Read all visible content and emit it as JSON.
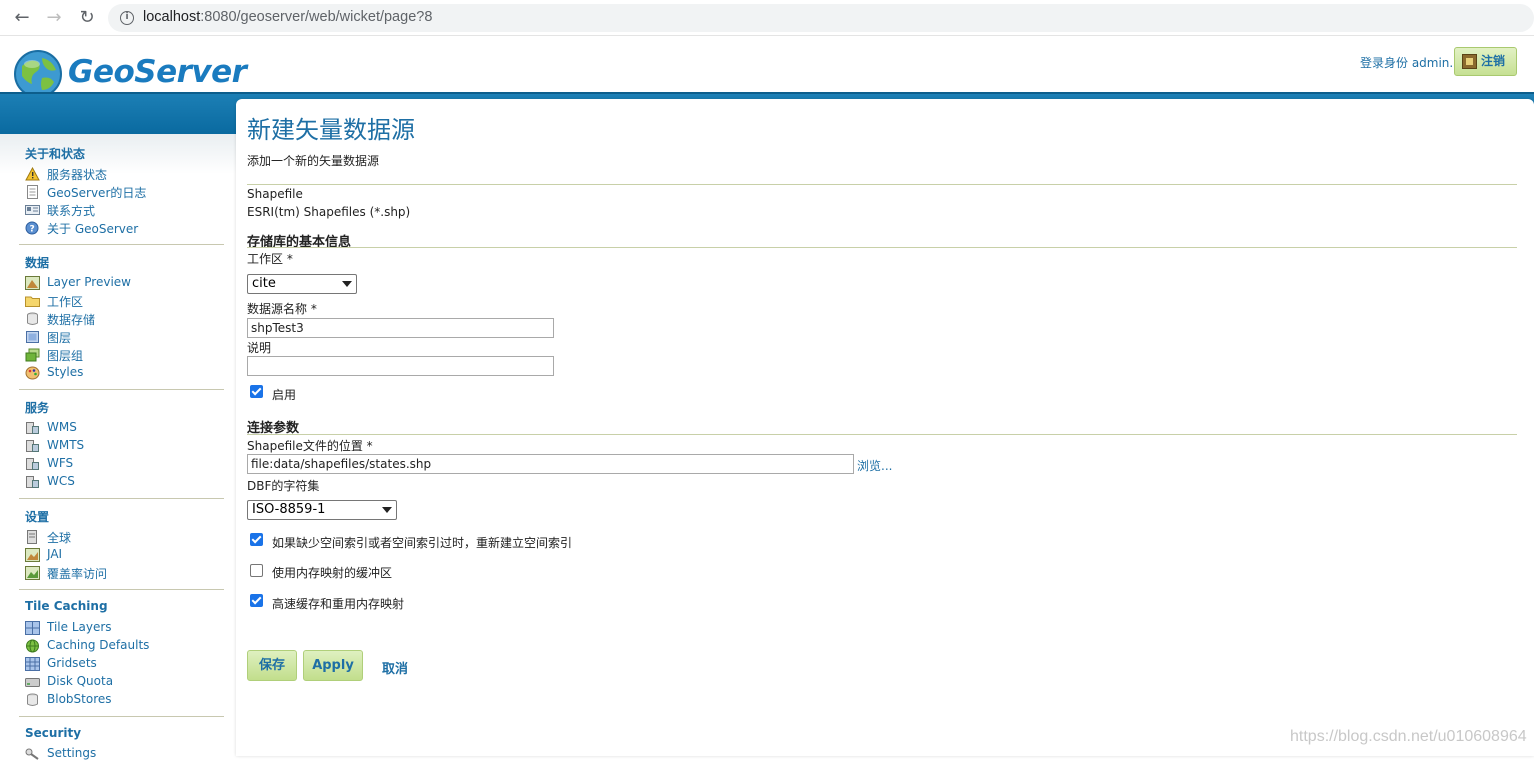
{
  "browser": {
    "url_host": "localhost",
    "url_rest": ":8080/geoserver/web/wicket/page?8"
  },
  "header": {
    "logo_text": "GeoServer",
    "login_as": "登录身份 admin.",
    "logout_label": "注销"
  },
  "sidebar": {
    "sections": [
      {
        "title": "关于和状态",
        "items": [
          "服务器状态",
          "GeoServer的日志",
          "联系方式",
          "关于 GeoServer"
        ]
      },
      {
        "title": "数据",
        "items": [
          "Layer Preview",
          "工作区",
          "数据存储",
          "图层",
          "图层组",
          "Styles"
        ]
      },
      {
        "title": "服务",
        "items": [
          "WMS",
          "WMTS",
          "WFS",
          "WCS"
        ]
      },
      {
        "title": "设置",
        "items": [
          "全球",
          "JAI",
          "覆盖率访问"
        ]
      },
      {
        "title": "Tile Caching",
        "items": [
          "Tile Layers",
          "Caching Defaults",
          "Gridsets",
          "Disk Quota",
          "BlobStores"
        ]
      },
      {
        "title": "Security",
        "items": [
          "Settings"
        ]
      }
    ]
  },
  "main": {
    "title": "新建矢量数据源",
    "description": "添加一个新的矢量数据源",
    "store_type": "Shapefile",
    "store_type_desc": "ESRI(tm) Shapefiles (*.shp)",
    "basic_info_heading": "存储库的基本信息",
    "workspace_label": "工作区 *",
    "workspace_value": "cite",
    "name_label": "数据源名称 *",
    "name_value": "shpTest3",
    "desc_label": "说明",
    "desc_value": "",
    "enabled_label": "启用",
    "conn_heading": "连接参数",
    "file_label": "Shapefile文件的位置 *",
    "file_value": "file:data/shapefiles/states.shp",
    "browse_label": "浏览...",
    "charset_label": "DBF的字符集",
    "charset_value": "ISO-8859-1",
    "opt1_label": "如果缺少空间索引或者空间索引过时，重新建立空间索引",
    "opt2_label": "使用内存映射的缓冲区",
    "opt3_label": "高速缓存和重用内存映射",
    "save_label": "保存",
    "apply_label": "Apply",
    "cancel_label": "取消"
  },
  "watermark": "https://blog.csdn.net/u010608964",
  "colors": {
    "accent": "#1e6fa5",
    "band": "#0a6aa0",
    "button": "#c6e093"
  }
}
